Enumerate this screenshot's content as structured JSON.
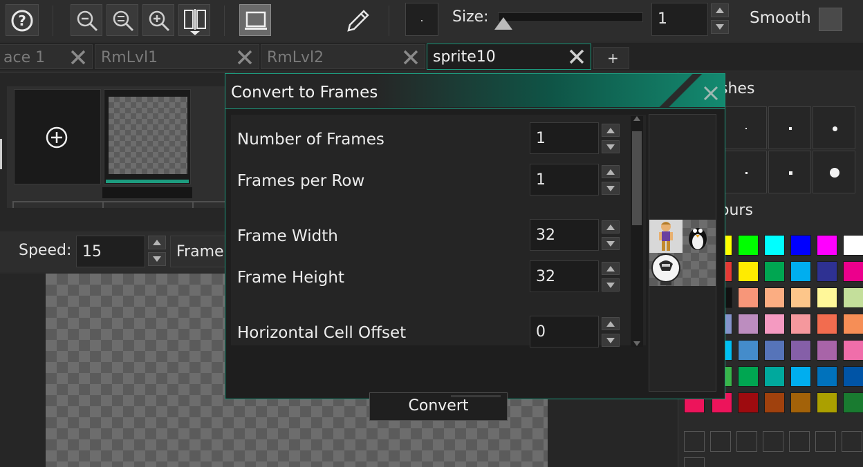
{
  "toolbar": {
    "size_label": "Size:",
    "size_value": "1",
    "smooth_label": "Smooth",
    "icons": [
      "help-icon",
      "zoom-out-icon",
      "zoom-reset-icon",
      "zoom-in-icon",
      "fit-icon",
      "monitor-icon",
      "pencil-icon"
    ]
  },
  "tabs": [
    {
      "label": "ace 1",
      "active": false
    },
    {
      "label": "RmLvl1",
      "active": false
    },
    {
      "label": "RmLvl2",
      "active": false
    },
    {
      "label": "sprite10",
      "active": true
    }
  ],
  "add_tab_label": "+",
  "speed": {
    "label": "Speed:",
    "value": "15",
    "mode_label": "Frame"
  },
  "right_panel": {
    "brushes_title": "shes",
    "colours_title": "ours"
  },
  "dialog": {
    "title": "Convert to Frames",
    "fields": [
      {
        "label": "Number of Frames",
        "value": "1"
      },
      {
        "label": "Frames per Row",
        "value": "1"
      },
      {
        "label": "Frame Width",
        "value": "32"
      },
      {
        "label": "Frame Height",
        "value": "32"
      },
      {
        "label": "Horizontal Cell Offset",
        "value": "0"
      }
    ],
    "convert_label": "Convert"
  },
  "colors": {
    "accent": "#1d9c7f",
    "swatches": [
      [
        "#ffff00",
        "#00ff00",
        "#00ffff",
        "#0000ff",
        "#ff00ff",
        "#ffffff"
      ],
      [
        "#e53935",
        "#ffeb00",
        "#00a651",
        "#00aeef",
        "#2e3192",
        "#ec008c"
      ],
      [
        "#111111",
        "#f79679",
        "#fbad82",
        "#fdc68a",
        "#fff799",
        "#c4df9b"
      ],
      [
        "#8493ca",
        "#bc8dbf",
        "#f49ac1",
        "#f5989d",
        "#f26c4f",
        "#f68e56"
      ],
      [
        "#00bff3",
        "#448ccb",
        "#5674b9",
        "#855fa8",
        "#a864a8",
        "#f06eaa"
      ],
      [
        "#39b54a",
        "#00a651",
        "#00a99d",
        "#00aeef",
        "#0072bc",
        "#0054a6"
      ],
      [
        "#ed145b",
        "#9e0b0f",
        "#a0410d",
        "#a36209",
        "#aba000",
        "#197b30"
      ]
    ]
  }
}
